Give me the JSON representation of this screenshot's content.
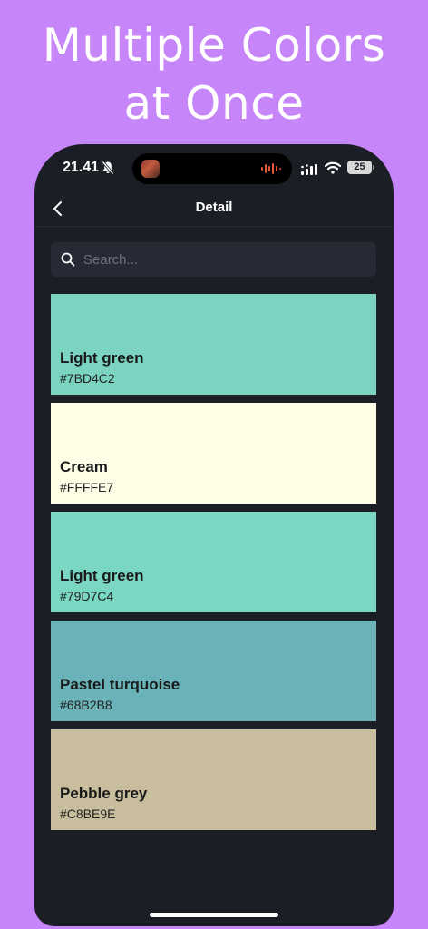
{
  "promo": {
    "line1": "Multiple Colors",
    "line2": "at Once"
  },
  "status_bar": {
    "time": "21.41",
    "battery": "25"
  },
  "header": {
    "title": "Detail"
  },
  "search": {
    "placeholder": "Search..."
  },
  "colors": [
    {
      "name": "Light green",
      "hex": "#7BD4C2"
    },
    {
      "name": "Cream",
      "hex": "#FFFFE7"
    },
    {
      "name": "Light green",
      "hex": "#79D7C4"
    },
    {
      "name": "Pastel turquoise",
      "hex": "#68B2B8"
    },
    {
      "name": "Pebble grey",
      "hex": "#C8BE9E"
    }
  ]
}
